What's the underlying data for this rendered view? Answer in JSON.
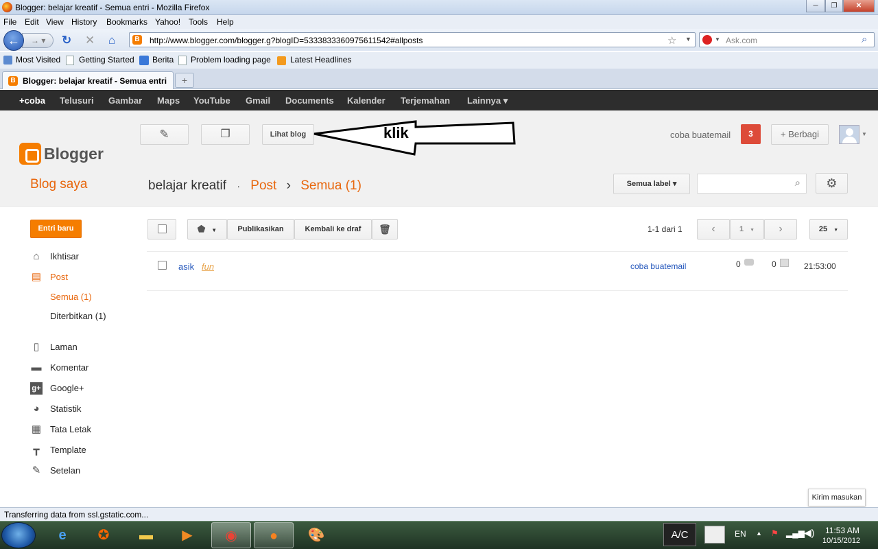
{
  "window": {
    "title": "Blogger: belajar kreatif - Semua entri - Mozilla Firefox"
  },
  "menu": [
    "File",
    "Edit",
    "View",
    "History",
    "Bookmarks",
    "Yahoo!",
    "Tools",
    "Help"
  ],
  "address": {
    "url": "http://www.blogger.com/blogger.g?blogID=5333833360975611542#allposts",
    "search_placeholder": "Ask.com"
  },
  "bookmarks": [
    "Most Visited",
    "Getting Started",
    "Berita",
    "Problem loading page",
    "Latest Headlines"
  ],
  "tab": {
    "label": "Blogger: belajar kreatif - Semua entri",
    "new_tab": "+"
  },
  "gbar": [
    "+coba",
    "Telusuri",
    "Gambar",
    "Maps",
    "YouTube",
    "Gmail",
    "Documents",
    "Kalender",
    "Terjemahan",
    "Lainnya ▾"
  ],
  "header": {
    "view_blog": "Lihat blog",
    "annotation": "klik",
    "user": "coba buatemail",
    "notif_count": "3",
    "share": "+ Berbagi",
    "brand": "Blogger"
  },
  "page": {
    "blog_saya": "Blog saya",
    "blog_name": "belajar kreatif",
    "sep1": "·",
    "post": "Post",
    "sep2": "›",
    "semua": "Semua (1)",
    "label_filter": "Semua label ▾"
  },
  "sidebar": {
    "new_post": "Entri baru",
    "items": [
      {
        "label": "Ikhtisar",
        "icon": "home-icon"
      },
      {
        "label": "Post",
        "icon": "posts-icon"
      },
      {
        "label": "Semua (1)"
      },
      {
        "label": "Diterbitkan (1)"
      },
      {
        "label": "Laman",
        "icon": "page-icon"
      },
      {
        "label": "Komentar",
        "icon": "comment-icon"
      },
      {
        "label": "Google+",
        "icon": "googleplus-icon"
      },
      {
        "label": "Statistik",
        "icon": "pie-chart-icon"
      },
      {
        "label": "Tata Letak",
        "icon": "layout-icon"
      },
      {
        "label": "Template",
        "icon": "paint-roller-icon"
      },
      {
        "label": "Setelan",
        "icon": "wrench-icon"
      }
    ]
  },
  "toolbar": {
    "publish": "Publikasikan",
    "revert": "Kembali ke draf",
    "pagination": "1-1 dari 1",
    "page_num": "1",
    "per_page": "25"
  },
  "posts": [
    {
      "title": "asik",
      "label": "fun",
      "author": "coba buatemail",
      "comments": "0",
      "views": "0",
      "time": "21:53:00"
    }
  ],
  "status_text": "Transferring data from ssl.gstatic.com...",
  "feedback": "Kirim masukan",
  "taskbar": {
    "lang": "EN",
    "time": "11:53 AM",
    "date": "10/15/2012",
    "ac": "A/C"
  }
}
